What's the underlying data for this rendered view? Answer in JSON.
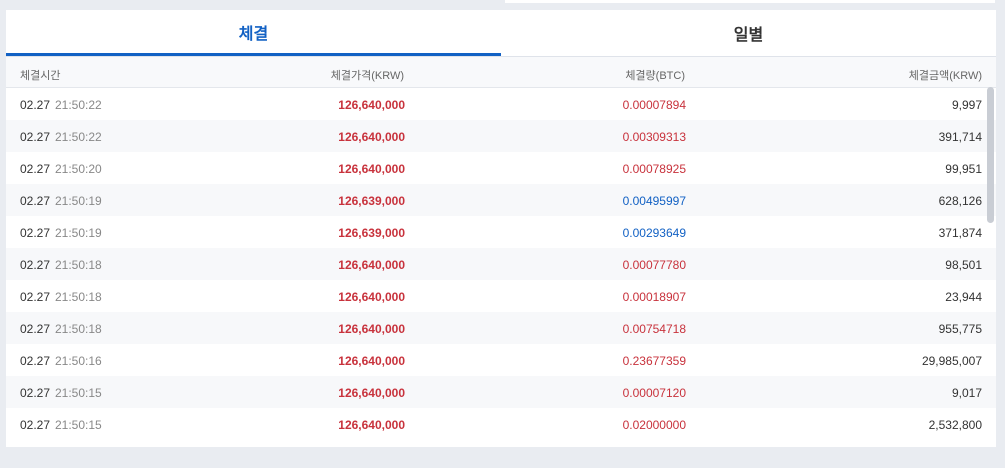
{
  "tabs": [
    {
      "label": "체결",
      "active": true
    },
    {
      "label": "일별",
      "active": false
    }
  ],
  "columns": {
    "time": "체결시간",
    "price": "체결가격(KRW)",
    "volume": "체결량(BTC)",
    "amount": "체결금액(KRW)"
  },
  "colors": {
    "accent": "#1261c4",
    "buy": "#c8323c",
    "sell": "#1261c4"
  },
  "trades": [
    {
      "date": "02.27",
      "time": "21:50:22",
      "price": "126,640,000",
      "volume": "0.00007894",
      "amount": "9,997",
      "side": "buy"
    },
    {
      "date": "02.27",
      "time": "21:50:22",
      "price": "126,640,000",
      "volume": "0.00309313",
      "amount": "391,714",
      "side": "buy"
    },
    {
      "date": "02.27",
      "time": "21:50:20",
      "price": "126,640,000",
      "volume": "0.00078925",
      "amount": "99,951",
      "side": "buy"
    },
    {
      "date": "02.27",
      "time": "21:50:19",
      "price": "126,639,000",
      "volume": "0.00495997",
      "amount": "628,126",
      "side": "sell"
    },
    {
      "date": "02.27",
      "time": "21:50:19",
      "price": "126,639,000",
      "volume": "0.00293649",
      "amount": "371,874",
      "side": "sell"
    },
    {
      "date": "02.27",
      "time": "21:50:18",
      "price": "126,640,000",
      "volume": "0.00077780",
      "amount": "98,501",
      "side": "buy"
    },
    {
      "date": "02.27",
      "time": "21:50:18",
      "price": "126,640,000",
      "volume": "0.00018907",
      "amount": "23,944",
      "side": "buy"
    },
    {
      "date": "02.27",
      "time": "21:50:18",
      "price": "126,640,000",
      "volume": "0.00754718",
      "amount": "955,775",
      "side": "buy"
    },
    {
      "date": "02.27",
      "time": "21:50:16",
      "price": "126,640,000",
      "volume": "0.23677359",
      "amount": "29,985,007",
      "side": "buy"
    },
    {
      "date": "02.27",
      "time": "21:50:15",
      "price": "126,640,000",
      "volume": "0.00007120",
      "amount": "9,017",
      "side": "buy"
    },
    {
      "date": "02.27",
      "time": "21:50:15",
      "price": "126,640,000",
      "volume": "0.02000000",
      "amount": "2,532,800",
      "side": "buy"
    }
  ]
}
